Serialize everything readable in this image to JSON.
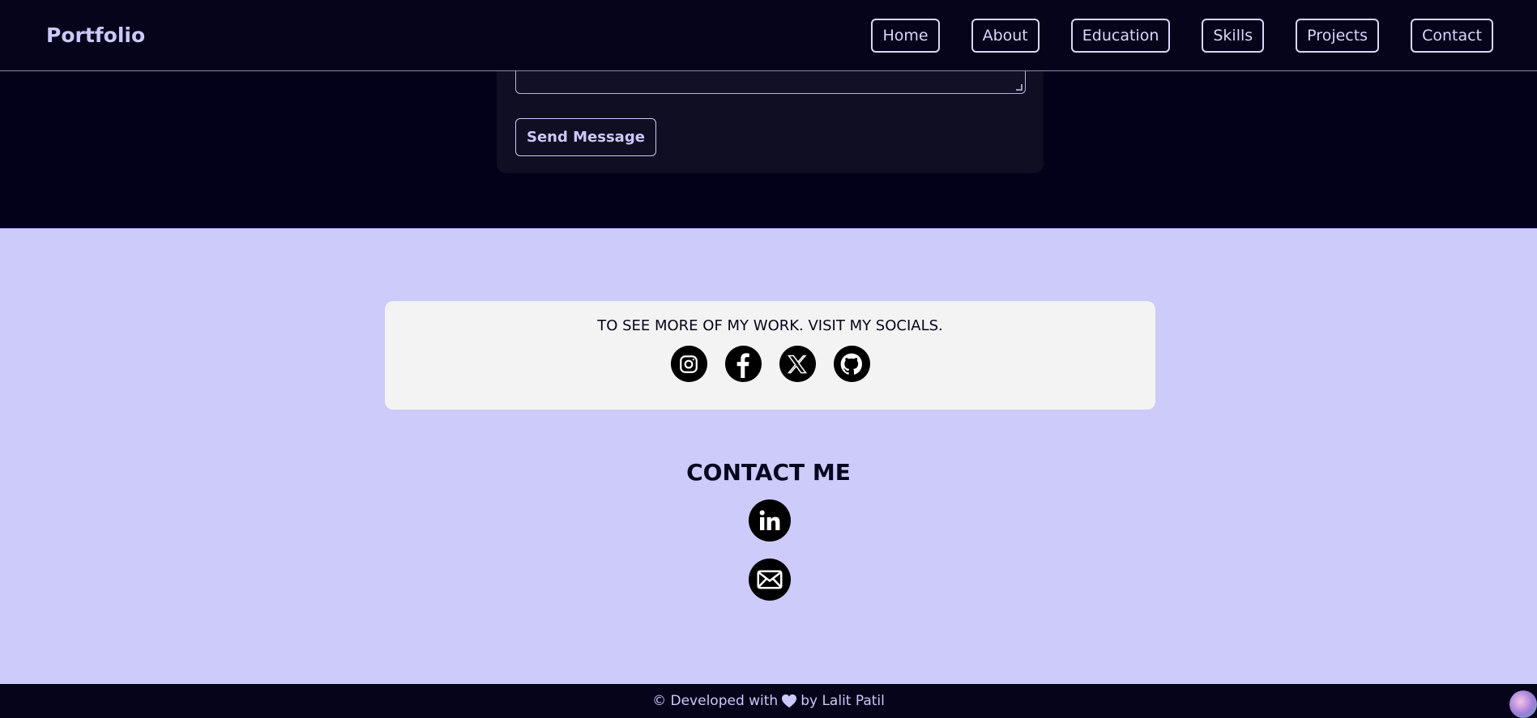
{
  "navbar": {
    "brand": "Portfolio",
    "links": [
      "Home",
      "About",
      "Education",
      "Skills",
      "Projects",
      "Contact"
    ]
  },
  "contact_form": {
    "send_label": "Send Message"
  },
  "socials": {
    "text": "TO SEE MORE OF MY WORK. VISIT MY SOCIALS.",
    "icons": [
      "instagram-icon",
      "facebook-icon",
      "x-icon",
      "github-icon"
    ]
  },
  "contact": {
    "title": "CONTACT ME",
    "icons": [
      "linkedin-icon",
      "mail-icon"
    ]
  },
  "footer": {
    "prefix": "© Developed with",
    "suffix": "by Lalit Patil"
  },
  "colors": {
    "dark_bg": "#03001a",
    "accent": "#cbc8fa",
    "footer_bg": "#cccbfa",
    "card_bg": "#f3f3f3"
  }
}
